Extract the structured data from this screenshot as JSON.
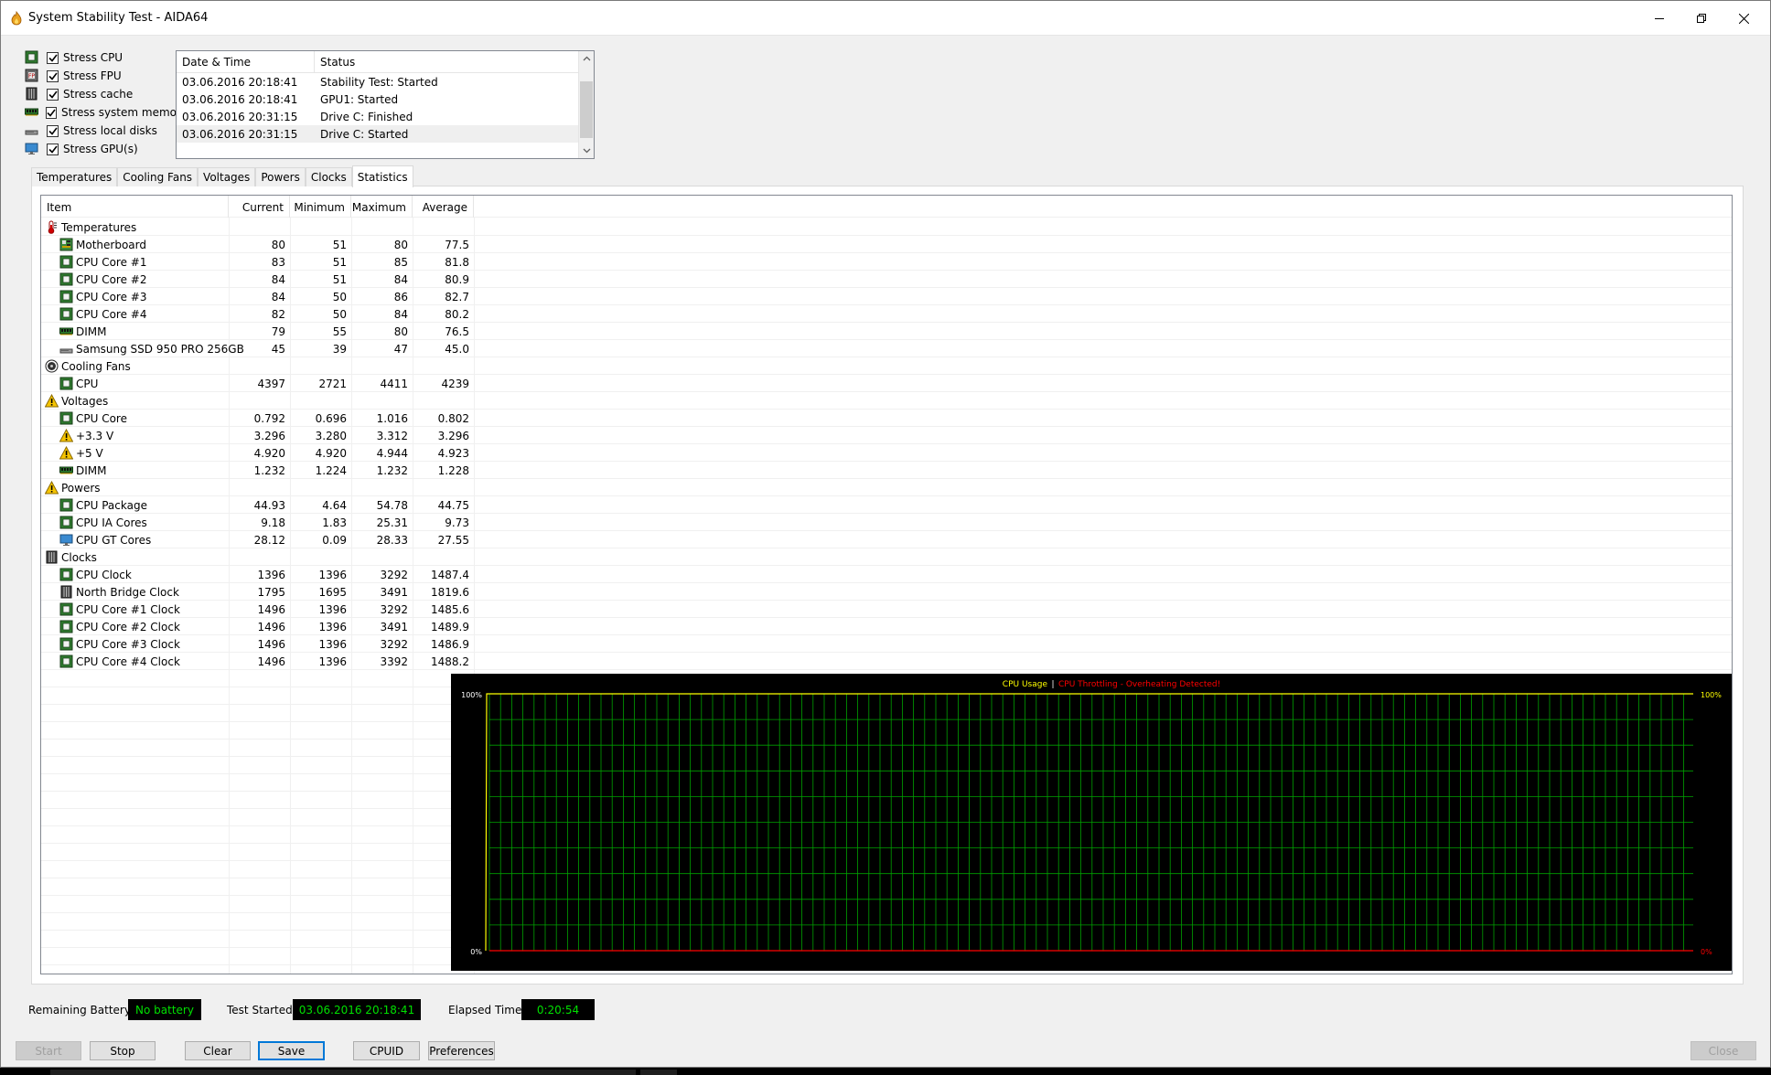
{
  "window": {
    "title": "System Stability Test - AIDA64"
  },
  "stress_options": [
    {
      "label": "Stress CPU",
      "icon": "cpu-chip-icon",
      "checked": true
    },
    {
      "label": "Stress FPU",
      "icon": "fpu-chip-icon",
      "checked": true
    },
    {
      "label": "Stress cache",
      "icon": "cache-icon",
      "checked": true
    },
    {
      "label": "Stress system memory",
      "icon": "memory-module-icon",
      "checked": true
    },
    {
      "label": "Stress local disks",
      "icon": "disk-drive-icon",
      "checked": true
    },
    {
      "label": "Stress GPU(s)",
      "icon": "monitor-icon",
      "checked": true
    }
  ],
  "log": {
    "headers": [
      "Date & Time",
      "Status"
    ],
    "rows": [
      {
        "time": "03.06.2016 20:18:41",
        "status": "Stability Test: Started"
      },
      {
        "time": "03.06.2016 20:18:41",
        "status": "GPU1: Started"
      },
      {
        "time": "03.06.2016 20:31:15",
        "status": "Drive C: Finished"
      },
      {
        "time": "03.06.2016 20:31:15",
        "status": "Drive C: Started"
      }
    ]
  },
  "tabs": [
    "Temperatures",
    "Cooling Fans",
    "Voltages",
    "Powers",
    "Clocks",
    "Statistics"
  ],
  "active_tab": "Statistics",
  "statistics": {
    "headers": [
      "Item",
      "Current",
      "Minimum",
      "Maximum",
      "Average"
    ],
    "rows": [
      {
        "level": 0,
        "icon": "thermometer-icon",
        "label": "Temperatures"
      },
      {
        "level": 1,
        "icon": "motherboard-icon",
        "label": "Motherboard",
        "current": "80",
        "min": "51",
        "max": "80",
        "avg": "77.5"
      },
      {
        "level": 1,
        "icon": "cpu-chip-icon",
        "label": "CPU Core #1",
        "current": "83",
        "min": "51",
        "max": "85",
        "avg": "81.8"
      },
      {
        "level": 1,
        "icon": "cpu-chip-icon",
        "label": "CPU Core #2",
        "current": "84",
        "min": "51",
        "max": "84",
        "avg": "80.9"
      },
      {
        "level": 1,
        "icon": "cpu-chip-icon",
        "label": "CPU Core #3",
        "current": "84",
        "min": "50",
        "max": "86",
        "avg": "82.7"
      },
      {
        "level": 1,
        "icon": "cpu-chip-icon",
        "label": "CPU Core #4",
        "current": "82",
        "min": "50",
        "max": "84",
        "avg": "80.2"
      },
      {
        "level": 1,
        "icon": "memory-module-icon",
        "label": "DIMM",
        "current": "79",
        "min": "55",
        "max": "80",
        "avg": "76.5"
      },
      {
        "level": 1,
        "icon": "disk-drive-icon",
        "label": "Samsung SSD 950 PRO 256GB",
        "current": "45",
        "min": "39",
        "max": "47",
        "avg": "45.0"
      },
      {
        "level": 0,
        "icon": "fan-icon",
        "label": "Cooling Fans"
      },
      {
        "level": 1,
        "icon": "cpu-chip-icon",
        "label": "CPU",
        "current": "4397",
        "min": "2721",
        "max": "4411",
        "avg": "4239"
      },
      {
        "level": 0,
        "icon": "warning-icon",
        "label": "Voltages"
      },
      {
        "level": 1,
        "icon": "cpu-chip-icon",
        "label": "CPU Core",
        "current": "0.792",
        "min": "0.696",
        "max": "1.016",
        "avg": "0.802"
      },
      {
        "level": 1,
        "icon": "warning-icon",
        "label": "+3.3 V",
        "current": "3.296",
        "min": "3.280",
        "max": "3.312",
        "avg": "3.296"
      },
      {
        "level": 1,
        "icon": "warning-icon",
        "label": "+5 V",
        "current": "4.920",
        "min": "4.920",
        "max": "4.944",
        "avg": "4.923"
      },
      {
        "level": 1,
        "icon": "memory-module-icon",
        "label": "DIMM",
        "current": "1.232",
        "min": "1.224",
        "max": "1.232",
        "avg": "1.228"
      },
      {
        "level": 0,
        "icon": "warning-icon",
        "label": "Powers"
      },
      {
        "level": 1,
        "icon": "cpu-chip-icon",
        "label": "CPU Package",
        "current": "44.93",
        "min": "4.64",
        "max": "54.78",
        "avg": "44.75"
      },
      {
        "level": 1,
        "icon": "cpu-chip-icon",
        "label": "CPU IA Cores",
        "current": "9.18",
        "min": "1.83",
        "max": "25.31",
        "avg": "9.73"
      },
      {
        "level": 1,
        "icon": "monitor-icon",
        "label": "CPU GT Cores",
        "current": "28.12",
        "min": "0.09",
        "max": "28.33",
        "avg": "27.55"
      },
      {
        "level": 0,
        "icon": "clock-bar-icon",
        "label": "Clocks"
      },
      {
        "level": 1,
        "icon": "cpu-chip-icon",
        "label": "CPU Clock",
        "current": "1396",
        "min": "1396",
        "max": "3292",
        "avg": "1487.4"
      },
      {
        "level": 1,
        "icon": "clock-bar-icon",
        "label": "North Bridge Clock",
        "current": "1795",
        "min": "1695",
        "max": "3491",
        "avg": "1819.6"
      },
      {
        "level": 1,
        "icon": "cpu-chip-icon",
        "label": "CPU Core #1 Clock",
        "current": "1496",
        "min": "1396",
        "max": "3292",
        "avg": "1485.6"
      },
      {
        "level": 1,
        "icon": "cpu-chip-icon",
        "label": "CPU Core #2 Clock",
        "current": "1496",
        "min": "1396",
        "max": "3491",
        "avg": "1489.9"
      },
      {
        "level": 1,
        "icon": "cpu-chip-icon",
        "label": "CPU Core #3 Clock",
        "current": "1496",
        "min": "1396",
        "max": "3292",
        "avg": "1486.9"
      },
      {
        "level": 1,
        "icon": "cpu-chip-icon",
        "label": "CPU Core #4 Clock",
        "current": "1496",
        "min": "1396",
        "max": "3392",
        "avg": "1488.2"
      }
    ]
  },
  "chart": {
    "title_usage": "CPU Usage",
    "title_sep": "|",
    "title_throttle": "CPU Throttling - Overheating Detected!",
    "left_top": "100%",
    "left_bottom": "0%",
    "right_top": "100%",
    "right_bottom": "0%",
    "usage_color": "#ffff00",
    "throttle_color": "#ff0000",
    "grid_color": "#00a000",
    "usage_values": [
      0,
      100
    ],
    "throttle_values": [
      0,
      0
    ]
  },
  "status": {
    "battery_label": "Remaining Battery:",
    "battery_value": "No battery",
    "started_label": "Test Started:",
    "started_value": "03.06.2016 20:18:41",
    "elapsed_label": "Elapsed Time:",
    "elapsed_value": "0:20:54"
  },
  "buttons": {
    "start": "Start",
    "stop": "Stop",
    "clear": "Clear",
    "save": "Save",
    "cpuid": "CPUID",
    "preferences": "Preferences",
    "close": "Close"
  }
}
